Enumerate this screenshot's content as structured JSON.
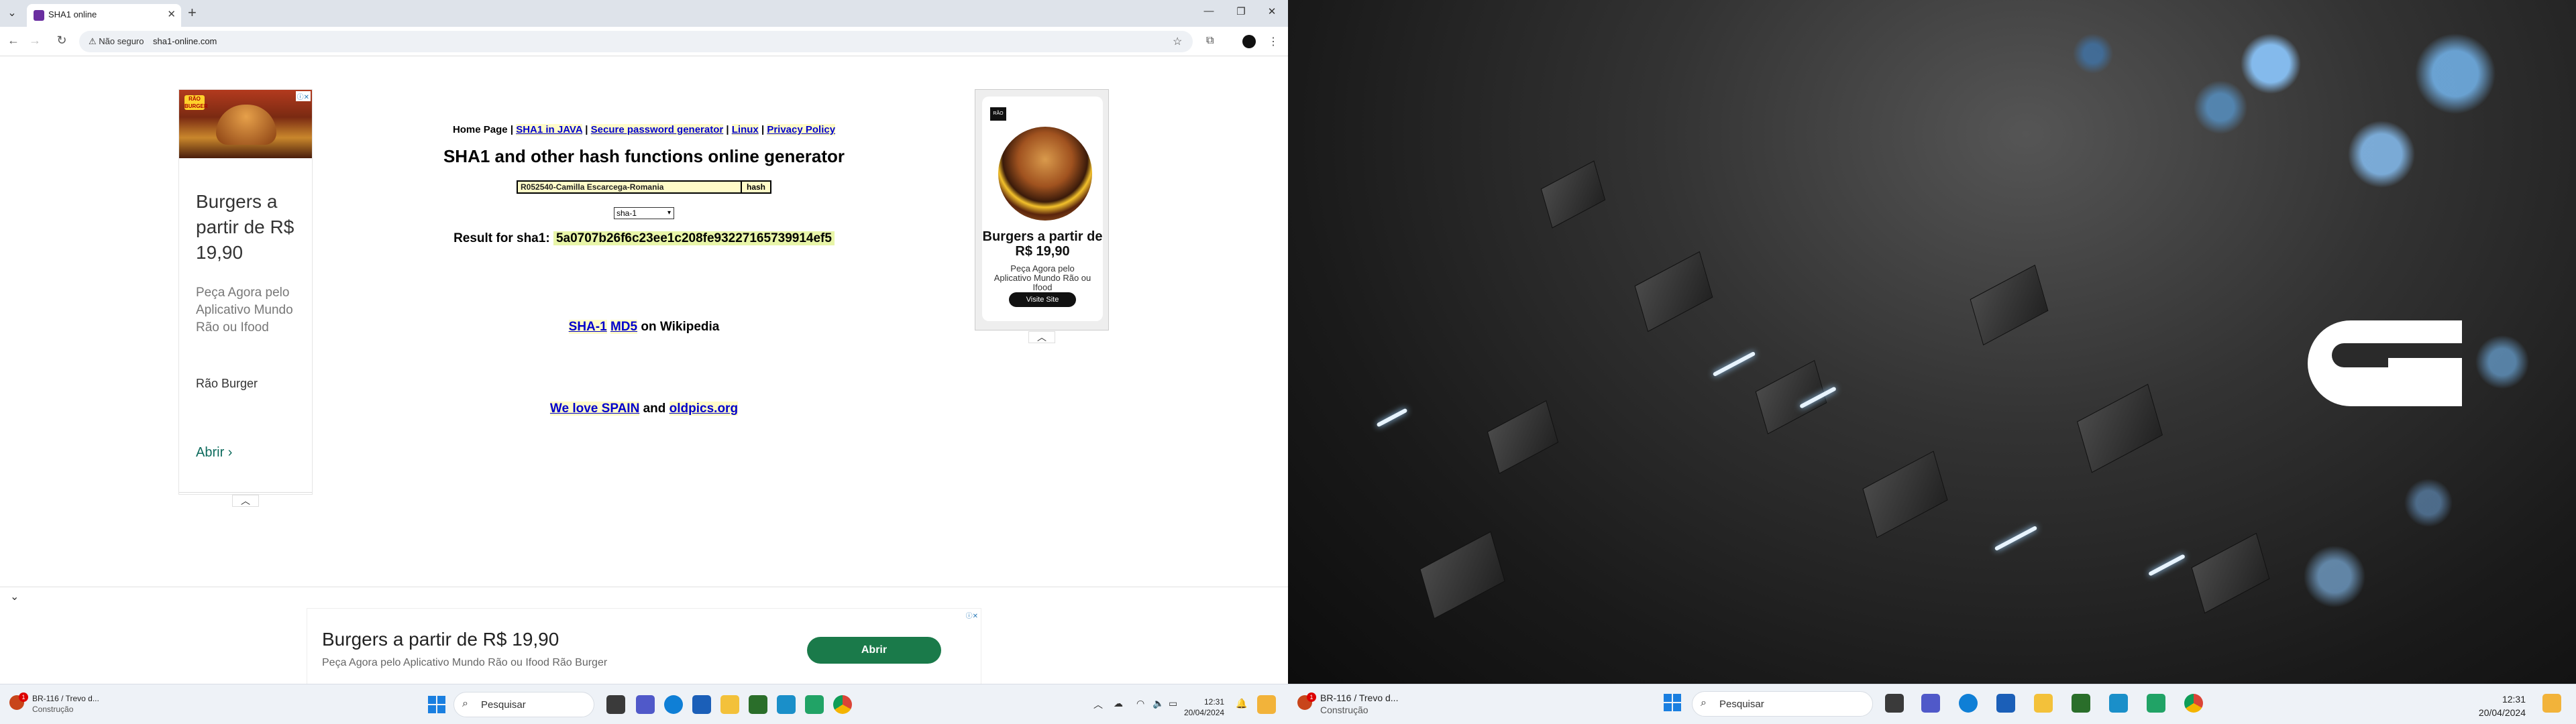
{
  "browser": {
    "tab_title": "SHA1 online",
    "not_secure_label": "Não seguro",
    "url": "sha1-online.com"
  },
  "page": {
    "nav": {
      "home": "Home Page",
      "sep": "|",
      "java": "SHA1 in JAVA",
      "password": "Secure password generator",
      "linux": "Linux",
      "privacy": "Privacy Policy"
    },
    "title": "SHA1 and other hash functions online generator",
    "input_value": "R052540-Camilla Escarcega-Romania",
    "hash_button": "hash",
    "algorithm": "sha-1",
    "result_label": "Result for sha1:",
    "result_value": "5a0707b26f6c23ee1c208fe93227165739914ef5",
    "wiki": {
      "sha1": "SHA-1",
      "md5": "MD5",
      "suffix": "on Wikipedia"
    },
    "love": {
      "spain": "We love SPAIN",
      "and": "and",
      "oldpics": "oldpics.org"
    }
  },
  "ads": {
    "left": {
      "headline": "Burgers a partir de R$ 19,90",
      "description": "Peça Agora pelo Aplicativo Mundo Rão ou Ifood",
      "brand": "Rão Burger",
      "open": "Abrir"
    },
    "right": {
      "headline": "Burgers a partir de R$ 19,90",
      "description": "Peça Agora pelo Aplicativo Mundo Rão ou Ifood",
      "cta": "Visite Site"
    },
    "bottom": {
      "headline": "Burgers a partir de R$ 19,90",
      "description": "Peça Agora pelo Aplicativo Mundo Rão ou Ifood Rão Burger",
      "button": "Abrir"
    }
  },
  "taskbar": {
    "weather_title": "BR-116 / Trevo d...",
    "weather_subtitle": "Construção",
    "search_placeholder": "Pesquisar",
    "time": "12:31",
    "date": "20/04/2024",
    "colors": {
      "start": "#1a7fe0",
      "accent": "#1a7a4a"
    }
  }
}
